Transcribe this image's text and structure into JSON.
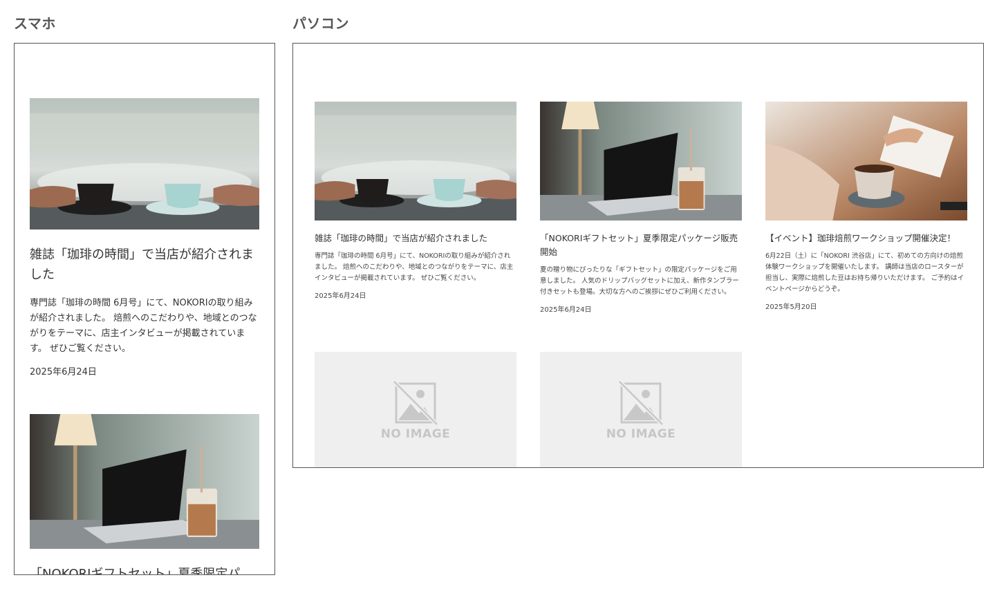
{
  "labels": {
    "mobile": "スマホ",
    "desktop": "パソコン"
  },
  "noimage_text": "NO IMAGE",
  "mobile": {
    "posts": [
      {
        "image": "coffee-cups-photo",
        "title": "雑誌「珈琲の時間」で当店が紹介されました",
        "description": "専門誌「珈琲の時間 6月号」にて、NOKORIの取り組みが紹介されました。 焙煎へのこだわりや、地域とのつながりをテーマに、店主インタビューが掲載されています。 ぜひご覧ください。",
        "date": "2025年6月24日"
      },
      {
        "image": "laptop-iced-coffee-photo",
        "title": "「NOKORIギフトセット」夏季限定パ"
      }
    ]
  },
  "desktop": {
    "posts": [
      {
        "image": "coffee-cups-photo",
        "title": "雑誌「珈琲の時間」で当店が紹介されました",
        "description": "専門誌「珈琲の時間 6月号」にて、NOKORIの取り組みが紹介されました。 焙煎へのこだわりや、地域とのつながりをテーマに、店主インタビューが掲載されています。 ぜひご覧ください。",
        "date": "2025年6月24日"
      },
      {
        "image": "laptop-iced-coffee-photo",
        "title": "「NOKORIギフトセット」夏季限定パッケージ販売開始",
        "description": "夏の贈り物にぴったりな「ギフトセット」の限定パッケージをご用意しました。 人気のドリップバッグセットに加え、新作タンブラー付きセットも登場。大切な方へのご挨拶にぜひご利用ください。",
        "date": "2025年6月24日"
      },
      {
        "image": "coffee-hands-table-photo",
        "title": "【イベント】珈琲焙煎ワークショップ開催決定！",
        "description": "6月22日（土）に「NOKORI 渋谷店」にて、初めての方向けの焙煎体験ワークショップを開催いたします。 講師は当店のロースターが担当し、実際に焙煎した豆はお持ち帰りいただけます。 ご予約はイベントページからどうぞ。",
        "date": "2025年5月20日"
      },
      {
        "image": "no-image-placeholder"
      },
      {
        "image": "no-image-placeholder"
      }
    ]
  }
}
